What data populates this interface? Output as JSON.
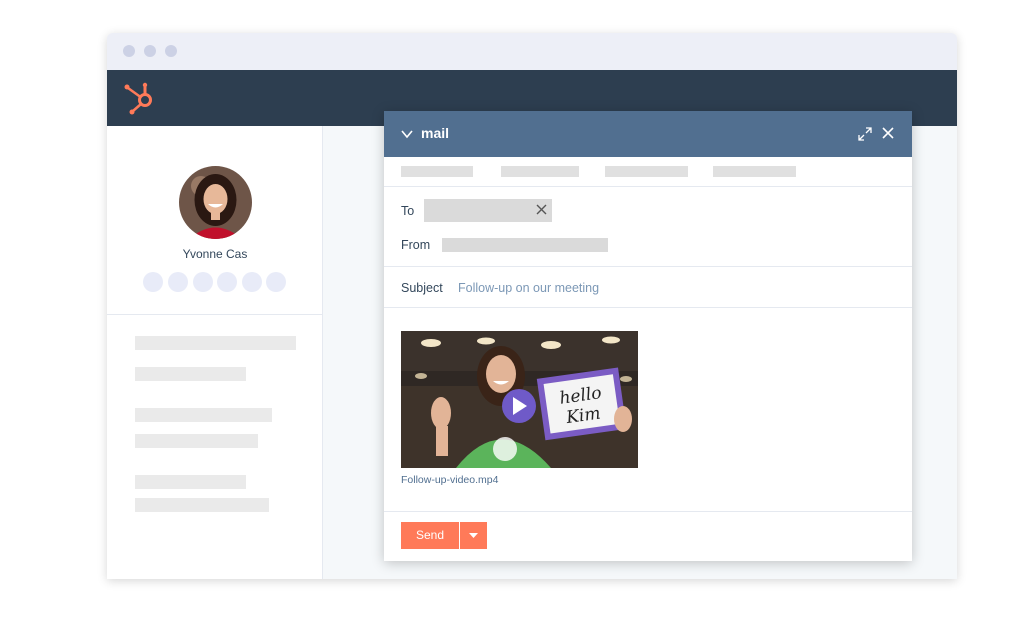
{
  "colors": {
    "app_bar": "#2d3e50",
    "composer_header": "#516f90",
    "accent": "#ff7a59",
    "logo": "#ff7a59"
  },
  "app": {
    "logo_icon": "hubspot-sprocket-icon"
  },
  "contact": {
    "name": "Yvonne Cas",
    "avatar_icon": "contact-avatar"
  },
  "composer": {
    "title": "mail",
    "collapse_icon": "chevron-down-icon",
    "expand_icon": "expand-icon",
    "close_icon": "close-icon",
    "to_label": "To",
    "from_label": "From",
    "subject_label": "Subject",
    "subject_value": "Follow-up on our meeting",
    "attachment": {
      "file_name": "Follow-up-video.mp4",
      "sign_line1": "hello",
      "sign_line2": "Kim",
      "play_icon": "play-icon"
    },
    "send_label": "Send",
    "send_menu_icon": "caret-down-icon"
  }
}
